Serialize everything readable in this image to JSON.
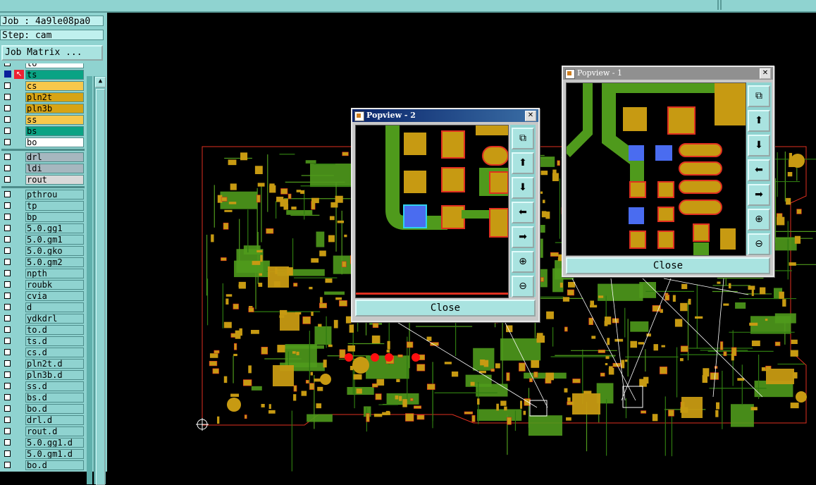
{
  "header": {
    "job": "Job : 4a9le08pa0",
    "step": "Step: cam",
    "job_matrix_label": "Job Matrix ..."
  },
  "layers": [
    {
      "name": "to",
      "color": "#ffffff",
      "partial": true
    },
    {
      "name": "ts",
      "color": "#0aa384",
      "active": true
    },
    {
      "name": "cs",
      "color": "#f7c84c"
    },
    {
      "name": "pln2t",
      "color": "#d7a415"
    },
    {
      "name": "pln3b",
      "color": "#d7a415"
    },
    {
      "name": "ss",
      "color": "#f7c84c"
    },
    {
      "name": "bs",
      "color": "#0aa384"
    },
    {
      "name": "bo",
      "color": "#ffffff"
    },
    {
      "name": "drl",
      "color": "#a6b7bf",
      "gap_before": true
    },
    {
      "name": "ldi",
      "color": "#a6b7bf"
    },
    {
      "name": "rout",
      "color": "#d9d9d9"
    },
    {
      "name": "pthrou",
      "color": "#8fd3d0",
      "gap_before": true
    },
    {
      "name": "tp",
      "color": "#8fd3d0"
    },
    {
      "name": "bp",
      "color": "#8fd3d0"
    },
    {
      "name": "5.0.gg1",
      "color": "#8fd3d0"
    },
    {
      "name": "5.0.gm1",
      "color": "#8fd3d0"
    },
    {
      "name": "5.0.gko",
      "color": "#8fd3d0"
    },
    {
      "name": "5.0.gm2",
      "color": "#8fd3d0"
    },
    {
      "name": "npth",
      "color": "#8fd3d0"
    },
    {
      "name": "roubk",
      "color": "#8fd3d0"
    },
    {
      "name": "cvia",
      "color": "#8fd3d0"
    },
    {
      "name": "d",
      "color": "#8fd3d0"
    },
    {
      "name": "ydkdrl",
      "color": "#8fd3d0"
    },
    {
      "name": "to.d",
      "color": "#8fd3d0"
    },
    {
      "name": "ts.d",
      "color": "#8fd3d0"
    },
    {
      "name": "cs.d",
      "color": "#8fd3d0"
    },
    {
      "name": "pln2t.d",
      "color": "#8fd3d0"
    },
    {
      "name": "pln3b.d",
      "color": "#8fd3d0"
    },
    {
      "name": "ss.d",
      "color": "#8fd3d0"
    },
    {
      "name": "bs.d",
      "color": "#8fd3d0"
    },
    {
      "name": "bo.d",
      "color": "#8fd3d0"
    },
    {
      "name": "drl.d",
      "color": "#8fd3d0"
    },
    {
      "name": "rout.d",
      "color": "#8fd3d0"
    },
    {
      "name": "5.0.gg1.d",
      "color": "#8fd3d0"
    },
    {
      "name": "5.0.gm1.d",
      "color": "#8fd3d0"
    },
    {
      "name": "bo.d",
      "color": "#8fd3d0",
      "partial": true
    }
  ],
  "popview1": {
    "title": "Popview - 1",
    "close_label": "Close",
    "close_x": "✕"
  },
  "popview2": {
    "title": "Popview - 2",
    "close_label": "Close",
    "close_x": "✕"
  },
  "popup_buttons": [
    "zoom-fit-icon",
    "pan-up-icon",
    "pan-down-icon",
    "pan-left-icon",
    "pan-right-icon",
    "zoom-in-icon",
    "zoom-out-icon"
  ],
  "popup_button_glyphs": [
    "⧉",
    "⬆",
    "⬇",
    "⬅",
    "➡",
    "⊕",
    "⊖"
  ],
  "colors": {
    "panel": "#8fd3d0",
    "copper": "#c79a12",
    "substrate": "#4f9a1c",
    "outline": "#e03020",
    "highlight": "#4a6cf0",
    "background": "#000000"
  }
}
